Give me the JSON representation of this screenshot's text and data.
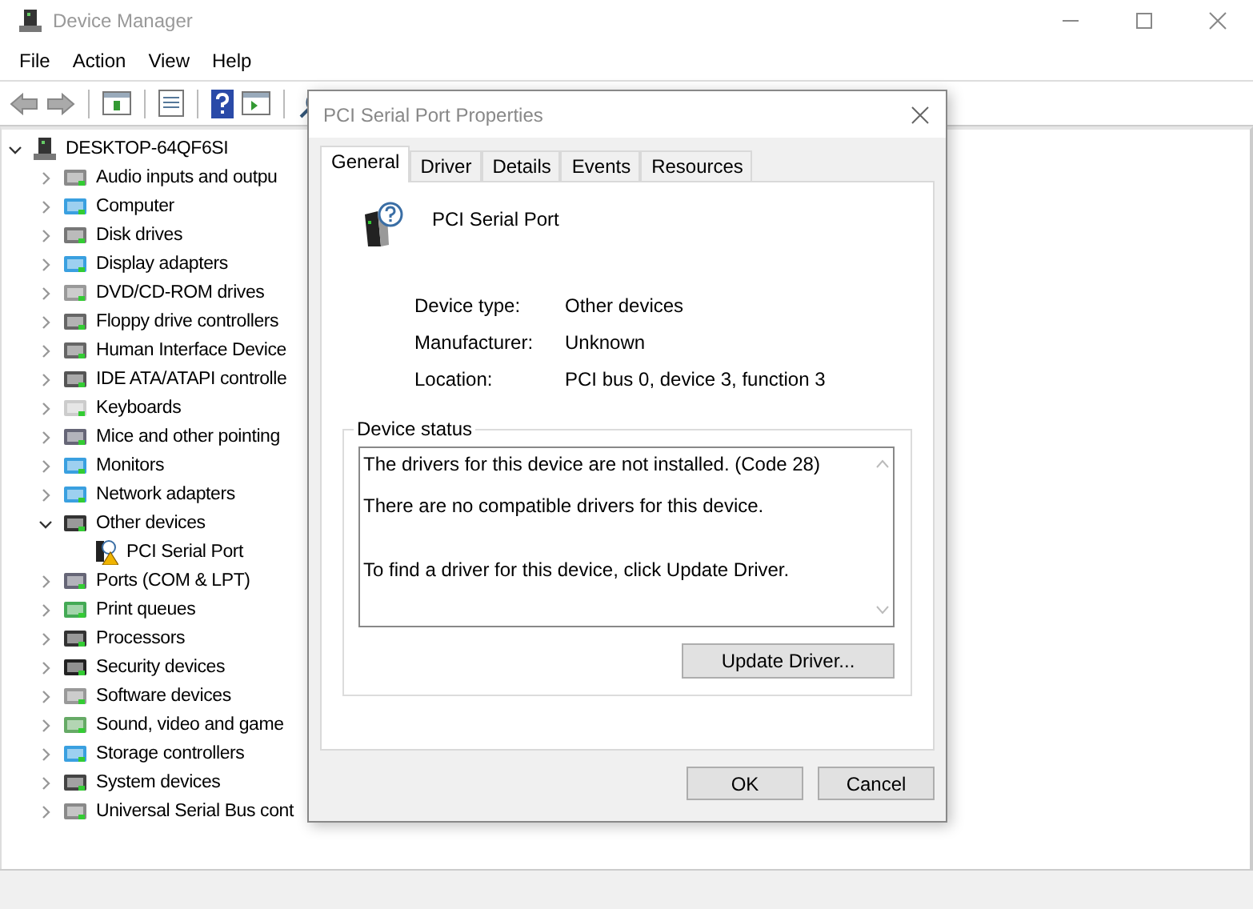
{
  "window": {
    "title": "Device Manager"
  },
  "menu": [
    "File",
    "Action",
    "View",
    "Help"
  ],
  "tree": {
    "label": "DESKTOP-64QF6SI",
    "expanded": true,
    "children": [
      {
        "label": "Audio inputs and outpu",
        "expanded": false
      },
      {
        "label": "Computer",
        "expanded": false
      },
      {
        "label": "Disk drives",
        "expanded": false
      },
      {
        "label": "Display adapters",
        "expanded": false
      },
      {
        "label": "DVD/CD-ROM drives",
        "expanded": false
      },
      {
        "label": "Floppy drive controllers",
        "expanded": false
      },
      {
        "label": "Human Interface Device",
        "expanded": false
      },
      {
        "label": "IDE ATA/ATAPI controlle",
        "expanded": false
      },
      {
        "label": "Keyboards",
        "expanded": false
      },
      {
        "label": "Mice and other pointing",
        "expanded": false
      },
      {
        "label": "Monitors",
        "expanded": false
      },
      {
        "label": "Network adapters",
        "expanded": false
      },
      {
        "label": "Other devices",
        "expanded": true,
        "children": [
          {
            "label": "PCI Serial Port"
          }
        ]
      },
      {
        "label": "Ports (COM & LPT)",
        "expanded": false
      },
      {
        "label": "Print queues",
        "expanded": false
      },
      {
        "label": "Processors",
        "expanded": false
      },
      {
        "label": "Security devices",
        "expanded": false
      },
      {
        "label": "Software devices",
        "expanded": false
      },
      {
        "label": "Sound, video and game",
        "expanded": false
      },
      {
        "label": "Storage controllers",
        "expanded": false
      },
      {
        "label": "System devices",
        "expanded": false
      },
      {
        "label": "Universal Serial Bus cont",
        "expanded": false
      }
    ]
  },
  "dialog": {
    "title": "PCI Serial Port Properties",
    "tabs": [
      {
        "label": "General",
        "selected": true
      },
      {
        "label": "Driver",
        "selected": false
      },
      {
        "label": "Details",
        "selected": false
      },
      {
        "label": "Events",
        "selected": false
      },
      {
        "label": "Resources",
        "selected": false
      }
    ],
    "device_name": "PCI Serial Port",
    "properties": [
      {
        "label": "Device type:",
        "value": "Other devices"
      },
      {
        "label": "Manufacturer:",
        "value": "Unknown"
      },
      {
        "label": "Location:",
        "value": "PCI bus 0, device 3, function 3"
      }
    ],
    "status_group": "Device status",
    "status_lines": [
      "The drivers for this device are not installed. (Code 28)",
      "There are no compatible drivers for this device.",
      "To find a driver for this device, click Update Driver."
    ],
    "update_button": "Update Driver...",
    "buttons": [
      "OK",
      "Cancel"
    ]
  }
}
